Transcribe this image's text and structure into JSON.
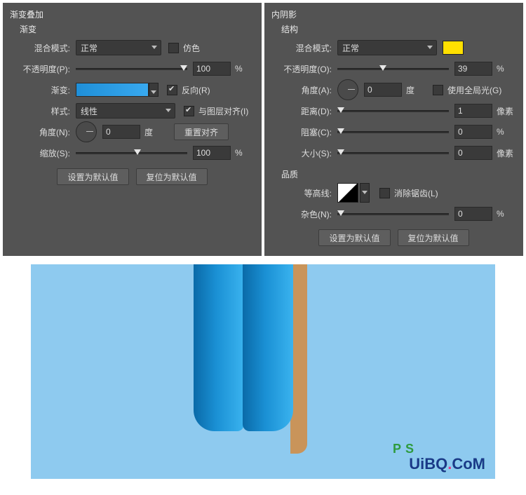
{
  "panels": {
    "gradient": {
      "title": "渐变叠加",
      "section": "渐变",
      "blendMode": {
        "label": "混合模式:",
        "value": "正常"
      },
      "dither": {
        "label": "仿色"
      },
      "opacity": {
        "label": "不透明度(P):",
        "value": "100",
        "unit": "%"
      },
      "gradient": {
        "label": "渐变:"
      },
      "reverse": {
        "label": "反向(R)"
      },
      "style": {
        "label": "样式:",
        "value": "线性"
      },
      "alignWithLayer": {
        "label": "与图层对齐(I)"
      },
      "angle": {
        "label": "角度(N):",
        "value": "0",
        "unit": "度"
      },
      "resetAlign": {
        "label": "重置对齐"
      },
      "scale": {
        "label": "缩放(S):",
        "value": "100",
        "unit": "%"
      },
      "btnDefault": "设置为默认值",
      "btnReset": "复位为默认值"
    },
    "innerShadow": {
      "title": "内阴影",
      "section1": "结构",
      "blendMode": {
        "label": "混合模式:",
        "value": "正常"
      },
      "color": "#ffe000",
      "opacity": {
        "label": "不透明度(O):",
        "value": "39",
        "unit": "%"
      },
      "angle": {
        "label": "角度(A):",
        "value": "0",
        "unit": "度"
      },
      "globalLight": {
        "label": "使用全局光(G)"
      },
      "distance": {
        "label": "距离(D):",
        "value": "1",
        "unit": "像素"
      },
      "choke": {
        "label": "阻塞(C):",
        "value": "0",
        "unit": "%"
      },
      "size": {
        "label": "大小(S):",
        "value": "0",
        "unit": "像素"
      },
      "section2": "品质",
      "contour": {
        "label": "等高线:"
      },
      "antiAlias": {
        "label": "消除锯齿(L)"
      },
      "noise": {
        "label": "杂色(N):",
        "value": "0",
        "unit": "%"
      },
      "btnDefault": "设置为默认值",
      "btnReset": "复位为默认值"
    }
  },
  "watermark": {
    "text": "UiBQ",
    "dot": ".",
    "tail": "CoM",
    "badge": "PS"
  }
}
